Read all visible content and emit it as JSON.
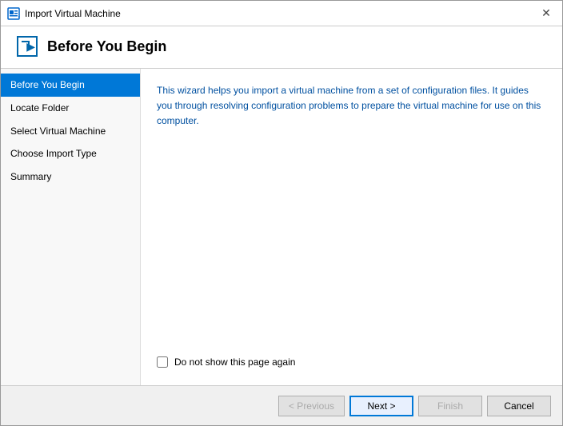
{
  "dialog": {
    "title": "Import Virtual Machine",
    "header_title": "Before You Begin",
    "description": "This wizard helps you import a virtual machine from a set of configuration files. It guides you through resolving configuration problems to prepare the virtual machine for use on this computer.",
    "checkbox_label": "Do not show this page again"
  },
  "sidebar": {
    "items": [
      {
        "label": "Before You Begin",
        "active": true
      },
      {
        "label": "Locate Folder",
        "active": false
      },
      {
        "label": "Select Virtual Machine",
        "active": false
      },
      {
        "label": "Choose Import Type",
        "active": false
      },
      {
        "label": "Summary",
        "active": false
      }
    ]
  },
  "footer": {
    "previous_label": "< Previous",
    "next_label": "Next >",
    "finish_label": "Finish",
    "cancel_label": "Cancel"
  }
}
